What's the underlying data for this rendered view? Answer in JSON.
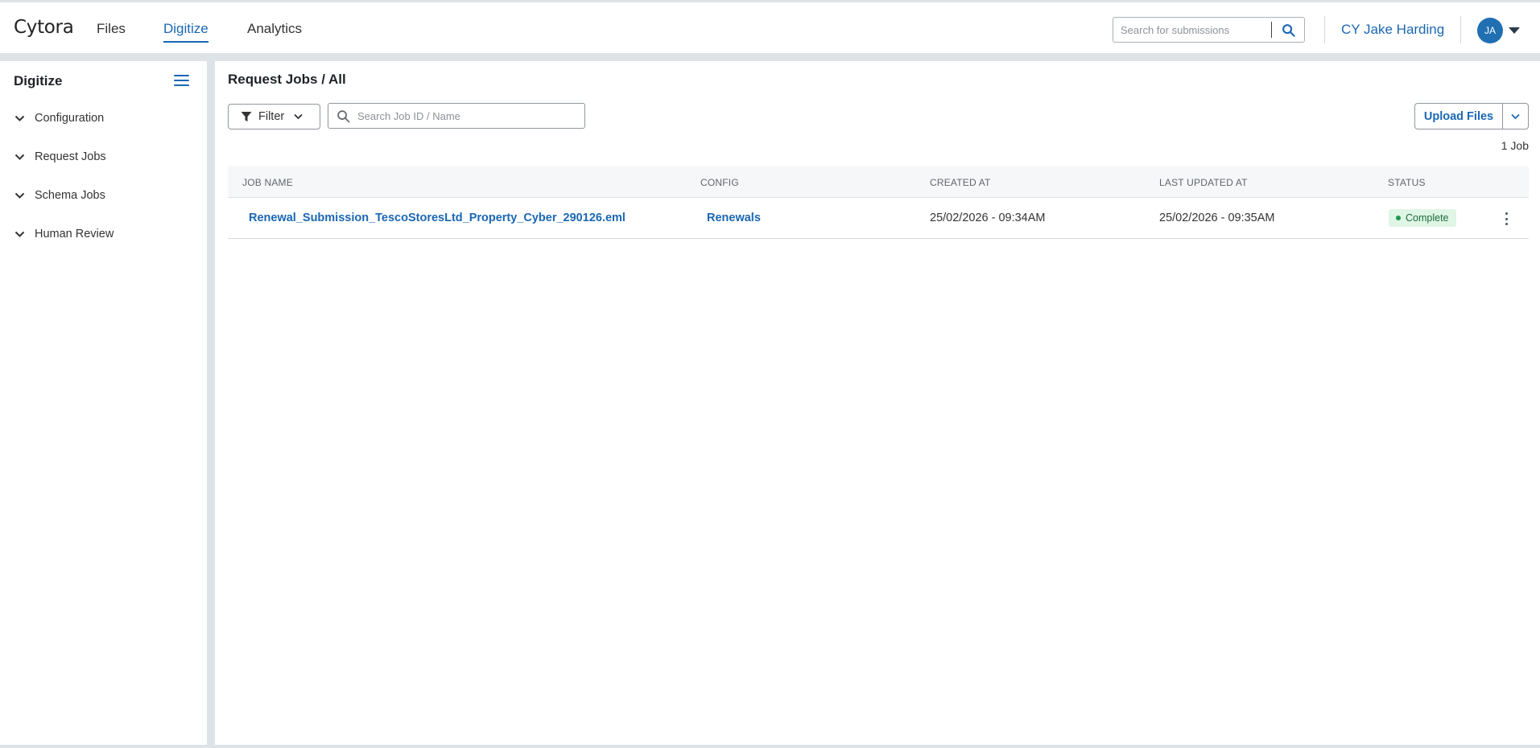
{
  "app": {
    "brand": "Cytora"
  },
  "nav": {
    "items": [
      {
        "label": "Files"
      },
      {
        "label": "Digitize"
      },
      {
        "label": "Analytics"
      }
    ]
  },
  "header": {
    "search_placeholder": "Search for submissions",
    "user_link": "CY Jake Harding",
    "avatar_initials": "JA"
  },
  "sidebar": {
    "title": "Digitize",
    "items": [
      {
        "label": "Configuration"
      },
      {
        "label": "Request Jobs"
      },
      {
        "label": "Schema Jobs"
      },
      {
        "label": "Human Review"
      }
    ]
  },
  "main": {
    "breadcrumb": "Request Jobs / All",
    "filter_label": "Filter",
    "job_search_placeholder": "Search Job ID / Name",
    "upload_label": "Upload Files",
    "count": "1 Job",
    "columns": [
      "JOB NAME",
      "CONFIG",
      "CREATED AT",
      "LAST UPDATED AT",
      "STATUS"
    ],
    "rows": [
      {
        "job_name": "Renewal_Submission_TescoStoresLtd_Property_Cyber_290126.eml",
        "config": "Renewals",
        "created_at": "25/02/2026 - 09:34AM",
        "updated_at": "25/02/2026 - 09:35AM",
        "status": "Complete"
      }
    ]
  },
  "colors": {
    "accent": "#1a67b3",
    "success": "#1d9a4f",
    "success_bg": "#dff5e6",
    "page_bg": "#dde3e6"
  },
  "icons": [
    "search-icon",
    "menu-icon",
    "chevron-down-icon",
    "filter-icon",
    "kebab-menu-icon",
    "caret-down-icon"
  ]
}
